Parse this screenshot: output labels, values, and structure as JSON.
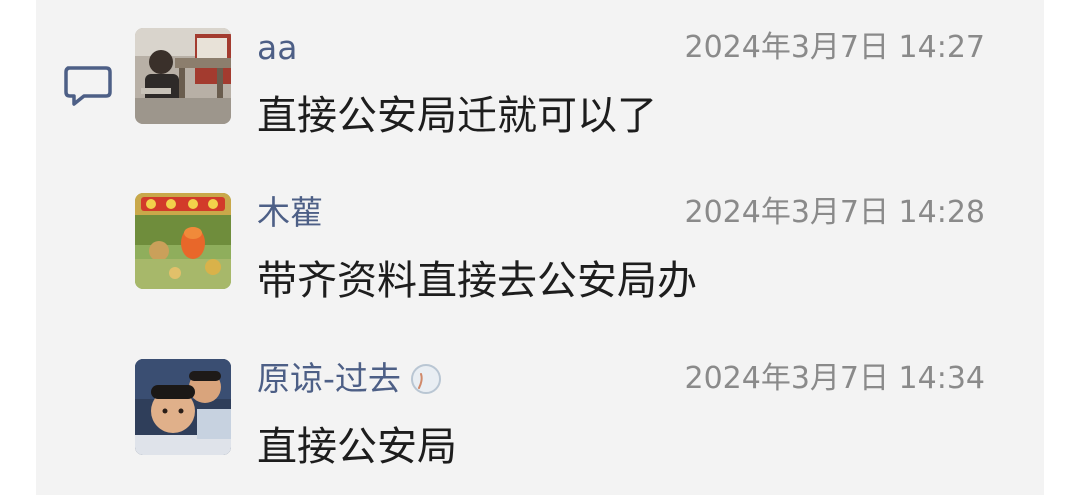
{
  "comments": [
    {
      "name": "aa",
      "time": "2024年3月7日 14:27",
      "text": "直接公安局迁就可以了",
      "avatar_icon": "photo-avatar-outdoor"
    },
    {
      "name": "木雚",
      "time": "2024年3月7日 14:28",
      "text": "带齐资料直接去公安局办",
      "avatar_icon": "photo-avatar-festival"
    },
    {
      "name": "原谅-过去",
      "time": "2024年3月7日 14:34",
      "text": "直接公安局",
      "avatar_icon": "photo-avatar-selfie",
      "badge_icon": "moon-badge-icon"
    }
  ],
  "colors": {
    "panel_bg": "#f3f3f3",
    "name": "#4d5f86",
    "time": "#8a8a8a",
    "text": "#1d1d1d",
    "comment_icon": "#4d5f86"
  }
}
